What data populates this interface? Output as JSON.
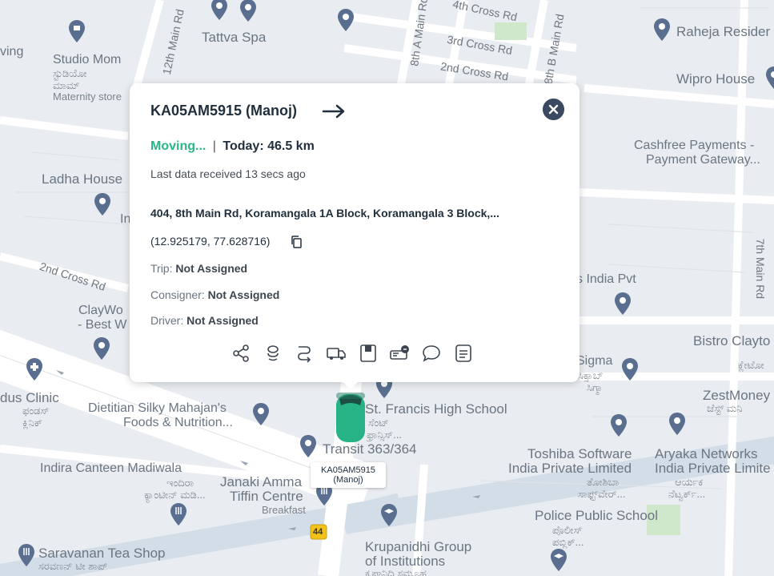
{
  "map": {
    "labels": {
      "tattva": "Tattva Spa",
      "studio_mom": "Studio Mom",
      "studio_mom_kn": "ಸ್ಟುಡಿಯೋ",
      "studio_mom_kn2": "ಮಾಮ್",
      "maternity": "Maternity store",
      "raheja": "Raheja Resider",
      "wipro": "Wipro House",
      "cashfree1": "Cashfree Payments -",
      "cashfree2": "Payment Gateway...",
      "ladha": "Ladha House",
      "cross4": "4th Cross Rd",
      "cross3": "3rd Cross Rd",
      "cross2_top": "2nd Cross Rd",
      "cross2_left": "2nd Cross Rd",
      "main12": "12th Main Rd",
      "main8a": "8th A Main Rd",
      "main8b": "8th B Main Rd",
      "main7": "7th Main Rd",
      "india_pvt": "s India Pvt",
      "claywo1": "ClayWo",
      "claywo2": "- Best W",
      "bistro": "Bistro Clayto",
      "bistro_kn": "ಕ್ಲೇಟೋ",
      "sigma": "Sigma",
      "sigma_kn1": "ಸಿಕ್ಸಾಬ್",
      "sigma_kn2": "ಸಿಗ್ಮಾ",
      "zest": "ZestMoney",
      "zest_kn": "ಜೆಸ್ಟ್ ಮನಿ",
      "clinic": "dus Clinic",
      "clinic_kn1": "ಫಂಡಸ್",
      "clinic_kn2": "ಕ್ಲಿನಿಕ್",
      "dietitian1": "Dietitian Silky Mahajan's",
      "dietitian2": "Foods & Nutrition...",
      "st_francis": "St. Francis High School",
      "st_francis_kn1": "ಸೆಂಟ್",
      "st_francis_kn2": "ಫ್ರಾನ್ಸಿಸ್...",
      "transit": "Transit 363/364",
      "toshiba1": "Toshiba Software",
      "toshiba2": "India Private Limited",
      "toshiba_kn1": "ತೋಶಿಬಾ",
      "toshiba_kn2": "ಸಾಫ್ಟ್‌ವೇರ್...",
      "aryaka1": "Aryaka Networks",
      "aryaka2": "India Private Limite",
      "aryaka_kn1": "ಆರ್ಯಕ",
      "aryaka_kn2": "ನೆಟ್ವರ್ಕ್...",
      "indira1": "Indira Canteen Madiwala",
      "indira_kn1": "ಇಂದಿರಾ",
      "indira_kn2": "ಕ್ಯಾಂಟೀನ್ ಮಡಿ...",
      "janaki1": "Janaki Amma",
      "janaki2": "Tiffin Centre",
      "breakfast": "Breakfast",
      "police1": "Police Public School",
      "police_kn1": "ಪೊಲೀಸ್",
      "police_kn2": "ಪಬ್ಲಿಕ್...",
      "krupanidhi1": "Krupanidhi Group",
      "krupanidhi2": "of Institutions",
      "krupanidhi_kn": "ಕೃಪಾನಿಧಿ ಸಮೂಹ",
      "saravanan": "Saravanan Tea Shop",
      "saravanan_kn": "ಸರವಣನ್ ಟೀ ಶಾಪ್",
      "ving": "ving",
      "in_partial": "In",
      "highway": "44"
    }
  },
  "popup": {
    "title": "KA05AM5915 (Manoj)",
    "status": "Moving...",
    "separator": "|",
    "today": "Today: 46.5 km",
    "last_data": "Last data received 13 secs ago",
    "address": "404, 8th Main Rd, Koramangala 1A Block, Koramangala 3 Block,...",
    "coords": "(12.925179, 77.628716)",
    "trip_label": "Trip:",
    "trip_value": "Not Assigned",
    "consigner_label": "Consigner:",
    "consigner_value": "Not Assigned",
    "driver_label": "Driver:",
    "driver_value": "Not Assigned"
  },
  "vehicle": {
    "label_line1": "KA05AM5915",
    "label_line2": "(Manoj)"
  },
  "colors": {
    "moving": "#2ab685",
    "close_bg": "#3a4a61",
    "car": "#27b386",
    "pin": "#5a6f8f",
    "highway_shield": "#f2c21b"
  },
  "icons": [
    "share-icon",
    "ignition-icon",
    "route-icon",
    "truck-icon",
    "document-icon",
    "fuel-icon",
    "chat-icon",
    "notes-icon"
  ]
}
